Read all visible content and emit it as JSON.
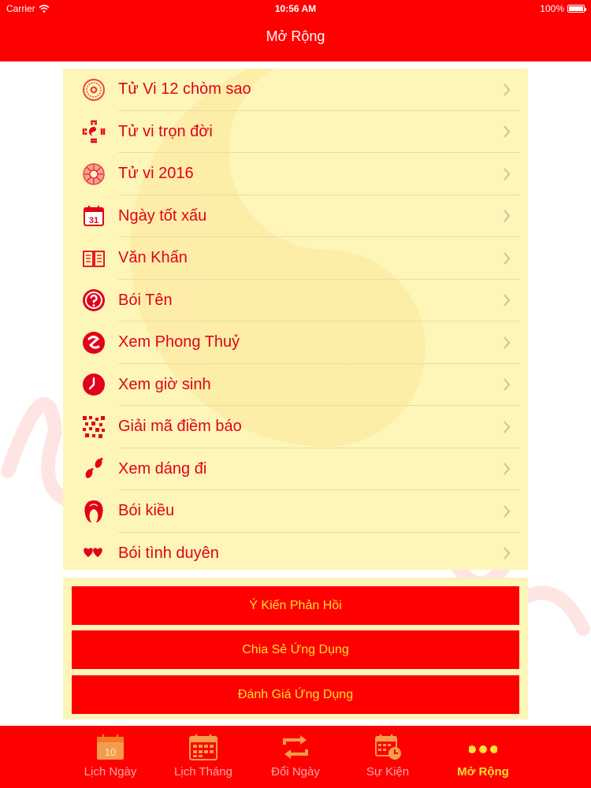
{
  "status_bar": {
    "carrier": "Carrier",
    "time": "10:56 AM",
    "battery": "100%"
  },
  "nav": {
    "title": "Mở Rộng"
  },
  "menu": {
    "items": [
      {
        "label": "Tử Vi 12 chòm sao",
        "icon": "zodiac-wheel-icon"
      },
      {
        "label": "Tử vi trọn đời",
        "icon": "bagua-icon"
      },
      {
        "label": "Tử vi 2016",
        "icon": "astrology-chart-icon"
      },
      {
        "label": "Ngày tốt xấu",
        "icon": "calendar-31-icon"
      },
      {
        "label": "Văn Khấn",
        "icon": "open-book-icon"
      },
      {
        "label": "Bói Tên",
        "icon": "question-circle-icon"
      },
      {
        "label": "Xem Phong Thuỷ",
        "icon": "yin-yang-icon"
      },
      {
        "label": "Xem giờ sinh",
        "icon": "clock-icon"
      },
      {
        "label": "Giải mã điềm báo",
        "icon": "qr-pattern-icon"
      },
      {
        "label": "Xem dáng đi",
        "icon": "footprints-icon"
      },
      {
        "label": "Bói kiều",
        "icon": "hair-icon"
      },
      {
        "label": "Bói tình duyên",
        "icon": "hearts-icon"
      }
    ]
  },
  "actions": {
    "feedback": "Ý Kiến Phản Hồi",
    "share": "Chia Sẻ Ứng Dụng",
    "rate": "Đánh Giá Ứng Dụng"
  },
  "tabs": [
    {
      "label": "Lịch Ngày",
      "icon": "day-calendar-icon",
      "badge": "10"
    },
    {
      "label": "Lịch Tháng",
      "icon": "month-calendar-icon"
    },
    {
      "label": "Đổi Ngày",
      "icon": "swap-arrows-icon"
    },
    {
      "label": "Sự Kiện",
      "icon": "event-calendar-icon"
    },
    {
      "label": "Mở Rộng",
      "icon": "more-dots-icon"
    }
  ],
  "active_tab": "Mở Rộng",
  "colors": {
    "primary_red": "#ff0000",
    "accent_yellow": "#ffe033",
    "panel_bg": "#fef6b8",
    "text_red": "#e2001a"
  }
}
